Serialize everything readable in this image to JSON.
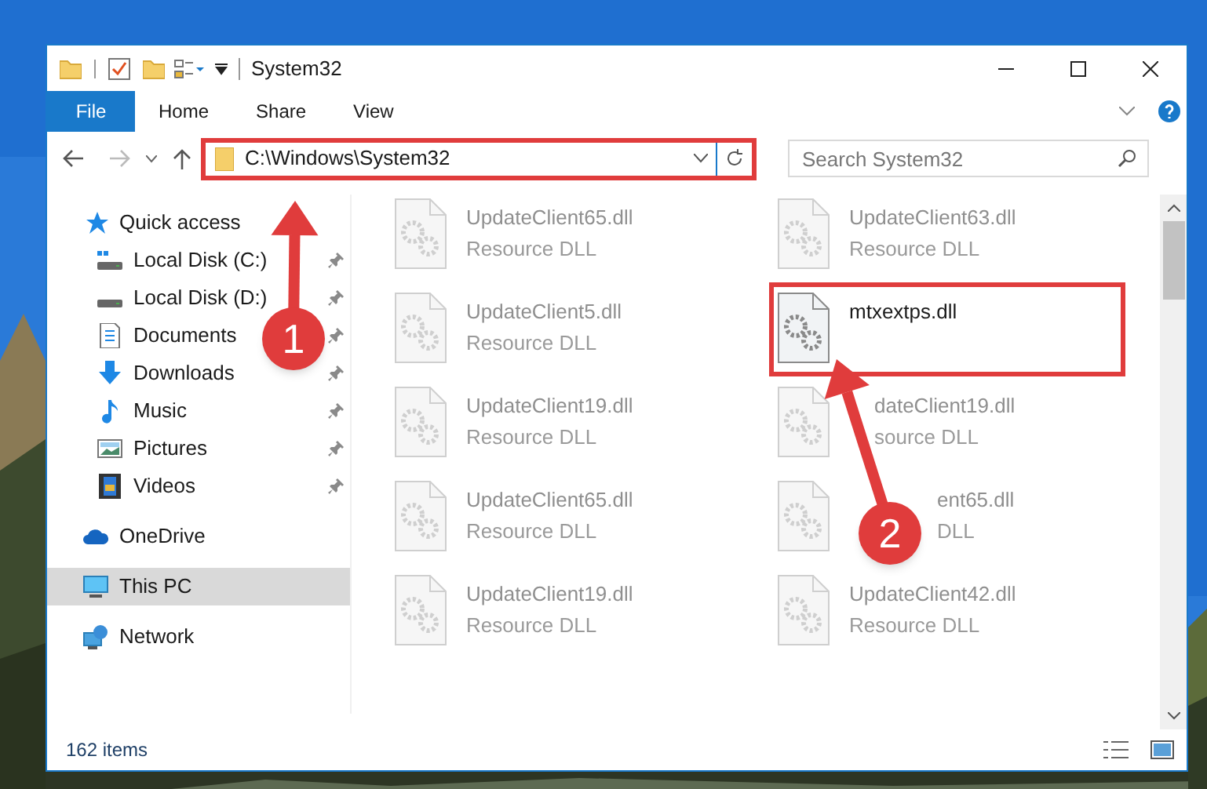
{
  "window": {
    "title": "System32"
  },
  "ribbon": {
    "tabs": [
      {
        "label": "File",
        "kind": "file"
      },
      {
        "label": "Home",
        "kind": "tab"
      },
      {
        "label": "Share",
        "kind": "tab"
      },
      {
        "label": "View",
        "kind": "tab"
      }
    ]
  },
  "address": {
    "path": "C:\\Windows\\System32",
    "highlighted": true
  },
  "search": {
    "placeholder": "Search System32"
  },
  "sidebar": {
    "items": [
      {
        "label": "Quick access",
        "kind": "star",
        "selected": false,
        "children": [
          {
            "label": "Local Disk (C:)",
            "kind": "disk-c",
            "pinned": true
          },
          {
            "label": "Local Disk (D:)",
            "kind": "disk",
            "pinned": true
          },
          {
            "label": "Documents",
            "kind": "document",
            "pinned": true
          },
          {
            "label": "Downloads",
            "kind": "download",
            "pinned": true
          },
          {
            "label": "Music",
            "kind": "music",
            "pinned": true
          },
          {
            "label": "Pictures",
            "kind": "pictures",
            "pinned": true
          },
          {
            "label": "Videos",
            "kind": "videos",
            "pinned": true
          }
        ]
      },
      {
        "label": "OneDrive",
        "kind": "cloud",
        "selected": false
      },
      {
        "label": "This PC",
        "kind": "pc",
        "selected": true
      },
      {
        "label": "Network",
        "kind": "network",
        "selected": false
      }
    ]
  },
  "files": [
    {
      "name": "UpdateClient65.dll",
      "type": "Resource DLL",
      "kind": "dimmed",
      "highlighted": false
    },
    {
      "name": "UpdateClient63.dll",
      "type": "Resource DLL",
      "kind": "dimmed",
      "highlighted": false
    },
    {
      "name": "UpdateClient5.dll",
      "type": "Resource DLL",
      "kind": "dimmed",
      "highlighted": false
    },
    {
      "name": "mtxextps.dll",
      "kind": "normal",
      "highlighted": true
    },
    {
      "name": "UpdateClient19.dll",
      "type": "Resource DLL",
      "kind": "dimmed",
      "highlighted": false
    },
    {
      "name": "dateClient19.dll",
      "type": "source DLL",
      "kind": "cut-short",
      "highlighted": false
    },
    {
      "name": "UpdateClient65.dll",
      "type": "Resource DLL",
      "kind": "dimmed",
      "highlighted": false
    },
    {
      "name": "ent65.dll",
      "type": "DLL",
      "kind": "cut-more",
      "highlighted": false
    },
    {
      "name": "UpdateClient19.dll",
      "type": "Resource DLL",
      "kind": "dimmed",
      "highlighted": false
    },
    {
      "name": "UpdateClient42.dll",
      "type": "Resource DLL",
      "kind": "dimmed",
      "highlighted": false
    }
  ],
  "status_bar": {
    "count": "162 items"
  },
  "annotations": [
    {
      "number": "1"
    },
    {
      "number": "2"
    }
  ]
}
